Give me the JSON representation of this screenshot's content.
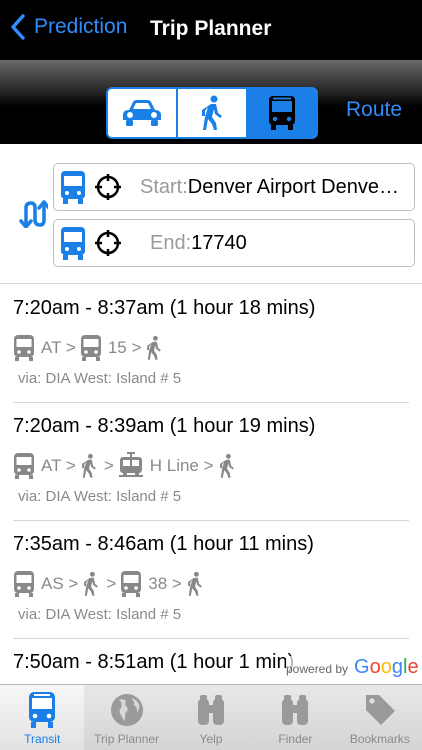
{
  "header": {
    "back_label": "Prediction",
    "title": "Trip Planner"
  },
  "modes": [
    {
      "icon": "car-icon",
      "active": false
    },
    {
      "icon": "walk-icon",
      "active": false
    },
    {
      "icon": "bus-icon",
      "active": true
    }
  ],
  "route_label": "Route",
  "inputs": {
    "start_label": "Start:",
    "start_value": "Denver Airport Denver Airport",
    "end_label": "End:",
    "end_value": "17740"
  },
  "results": [
    {
      "time": "7:20am - 8:37am (1 hour 18 mins)",
      "legs": [
        {
          "icon": "bus-icon",
          "text": "AT >"
        },
        {
          "icon": "bus-icon",
          "text": "15 >"
        },
        {
          "icon": "walk-icon",
          "text": ""
        }
      ],
      "via": "via: DIA West: Island # 5"
    },
    {
      "time": "7:20am - 8:39am (1 hour 19 mins)",
      "legs": [
        {
          "icon": "bus-icon",
          "text": "AT >"
        },
        {
          "icon": "walk-icon",
          "text": ">"
        },
        {
          "icon": "train-icon",
          "text": "H Line >"
        },
        {
          "icon": "walk-icon",
          "text": ""
        }
      ],
      "via": "via: DIA West: Island # 5"
    },
    {
      "time": "7:35am - 8:46am (1 hour 11 mins)",
      "legs": [
        {
          "icon": "bus-icon",
          "text": "AS >"
        },
        {
          "icon": "walk-icon",
          "text": ">"
        },
        {
          "icon": "bus-icon",
          "text": "38 >"
        },
        {
          "icon": "walk-icon",
          "text": ""
        }
      ],
      "via": "via: DIA West: Island # 5"
    },
    {
      "time": "7:50am - 8:51am (1 hour 1 min)",
      "legs": [],
      "via": ""
    }
  ],
  "attribution": {
    "powered": "powered by",
    "google": [
      "G",
      "o",
      "o",
      "g",
      "l",
      "e"
    ]
  },
  "tabs": [
    {
      "label": "Transit",
      "icon": "bus-icon",
      "active": true
    },
    {
      "label": "Trip Planner",
      "icon": "globe-icon",
      "active": false
    },
    {
      "label": "Yelp",
      "icon": "binoculars-icon",
      "active": false
    },
    {
      "label": "Finder",
      "icon": "binoculars-icon",
      "active": false
    },
    {
      "label": "Bookmarks",
      "icon": "tag-icon",
      "active": false
    }
  ],
  "colors": {
    "accent": "#1a7fe6",
    "link": "#2f8cff",
    "muted": "#8a8a8a"
  }
}
